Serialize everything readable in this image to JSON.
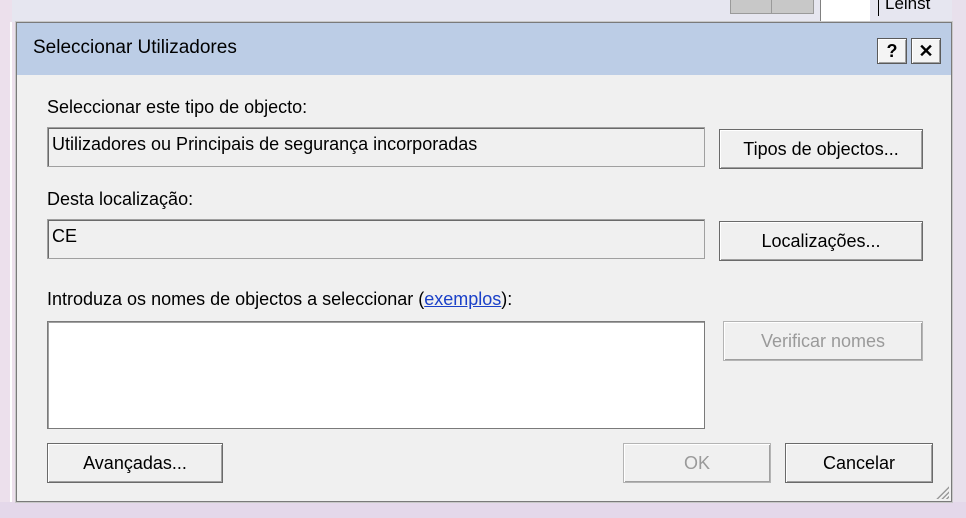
{
  "background": {
    "window_text": "Lelnst"
  },
  "dialog": {
    "title": "Seleccionar Utilizadores",
    "help_glyph": "?",
    "close_glyph": "✕",
    "object_type": {
      "label": "Seleccionar este tipo de objecto:",
      "value": "Utilizadores ou Principais de segurança incorporadas",
      "button": "Tipos de objectos..."
    },
    "location": {
      "label": "Desta localização:",
      "value": "CE",
      "button": "Localizações..."
    },
    "names": {
      "label_prefix": "Introduza os nomes de objectos a seleccionar (",
      "label_link": "exemplos",
      "label_suffix": "):",
      "value": "",
      "check_button": "Verificar nomes"
    },
    "footer": {
      "advanced_button": "Avançadas...",
      "ok_button": "OK",
      "cancel_button": "Cancelar"
    }
  },
  "colors": {
    "titlebar": "#bccde6",
    "dialog_bg": "#f0f0f0",
    "link": "#1a40c8",
    "disabled_text": "#9a9a9a"
  }
}
